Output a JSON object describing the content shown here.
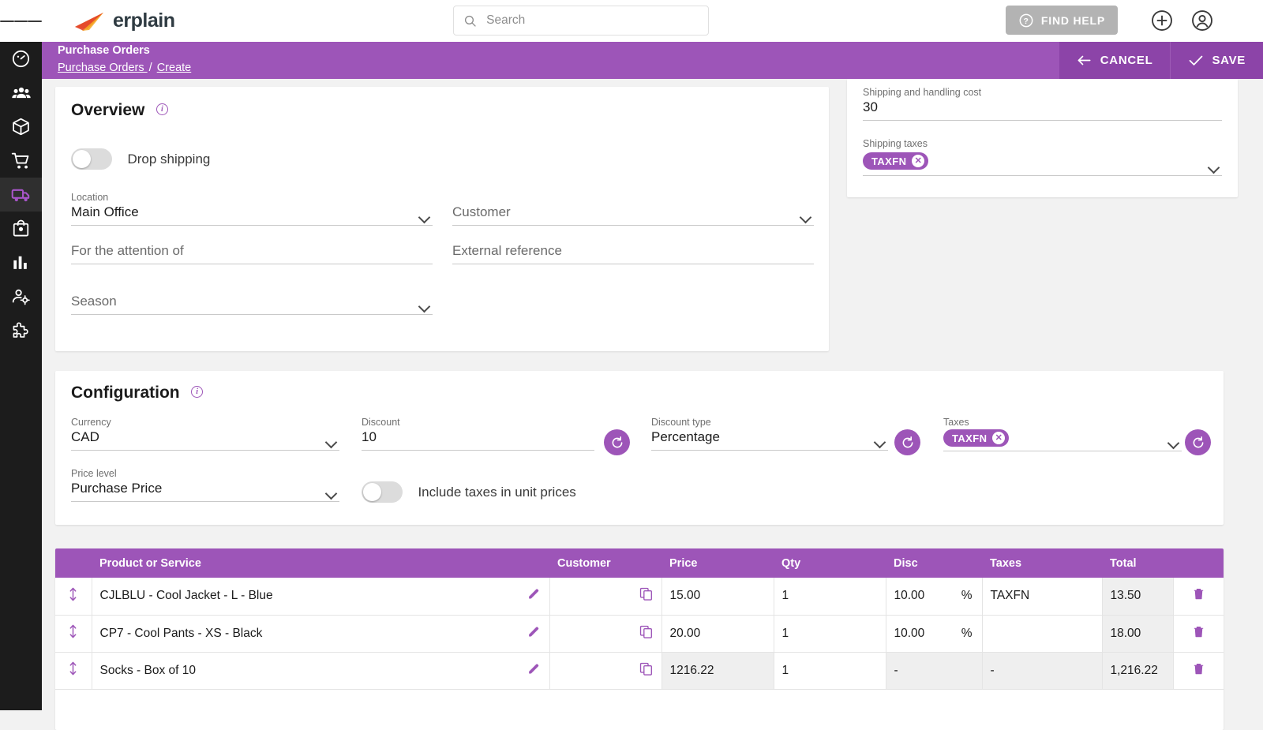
{
  "app": {
    "logo_text": "erplain",
    "accent_purple": "#9d55b8",
    "accent_purple_dark": "#8c44a8",
    "sidebar_bg": "#1c1c1c"
  },
  "topbar": {
    "menu_icon": "hamburger-menu-icon",
    "search": {
      "value": "",
      "placeholder": "Search",
      "icon": "search-icon"
    },
    "find_help_label": "FIND HELP",
    "find_help_icon": "question-circle-icon",
    "add_icon": "plus-circle-icon",
    "account_icon": "user-circle-icon"
  },
  "sidebar": {
    "items": [
      {
        "name": "dashboard",
        "icon": "speedometer-icon",
        "active": false
      },
      {
        "name": "customers",
        "icon": "people-icon",
        "active": false
      },
      {
        "name": "products",
        "icon": "package-box-icon",
        "active": false
      },
      {
        "name": "sales-orders",
        "icon": "shopping-cart-icon",
        "active": false
      },
      {
        "name": "purchase-orders",
        "icon": "truck-icon",
        "active": true
      },
      {
        "name": "inventory",
        "icon": "shopping-bag-icon",
        "active": false
      },
      {
        "name": "reports",
        "icon": "bar-chart-icon",
        "active": false
      },
      {
        "name": "user-settings",
        "icon": "user-gear-icon",
        "active": false
      },
      {
        "name": "integrations",
        "icon": "puzzle-piece-icon",
        "active": false
      }
    ]
  },
  "pageheader": {
    "title": "Purchase Orders",
    "breadcrumb_parent": "Purchase Orders ",
    "breadcrumb_sep": "/",
    "breadcrumb_current": "Create",
    "cancel_label": "CANCEL",
    "cancel_icon": "arrow-left-icon",
    "save_label": "SAVE",
    "save_icon": "check-icon"
  },
  "overview": {
    "title": "Overview",
    "info_icon": "info-icon",
    "drop_shipping": {
      "label": "Drop shipping",
      "enabled": false
    },
    "location": {
      "label": "Location",
      "value": "Main Office",
      "placeholder": ""
    },
    "customer": {
      "label": "",
      "value": "",
      "placeholder": "Customer"
    },
    "attention": {
      "label": "",
      "value": "",
      "placeholder": "For the attention of"
    },
    "external_reference": {
      "label": "",
      "value": "",
      "placeholder": "External reference"
    },
    "season": {
      "label": "",
      "value": "",
      "placeholder": "Season"
    }
  },
  "shipping": {
    "cost": {
      "label": "Shipping and handling cost",
      "value": "30"
    },
    "taxes": {
      "label": "Shipping taxes",
      "chips": [
        "TAXFN"
      ]
    }
  },
  "configuration": {
    "title": "Configuration",
    "info_icon": "info-icon",
    "currency": {
      "label": "Currency",
      "value": "CAD"
    },
    "discount": {
      "label": "Discount",
      "value": "10"
    },
    "discount_type": {
      "label": "Discount type",
      "value": "Percentage"
    },
    "taxes": {
      "label": "Taxes",
      "chips": [
        "TAXFN"
      ]
    },
    "price_level": {
      "label": "Price level",
      "value": "Purchase Price"
    },
    "include_taxes": {
      "label": "Include taxes in unit prices",
      "enabled": false
    },
    "refresh_icon": "refresh-icon"
  },
  "lines_table": {
    "columns": [
      "",
      "Product or Service",
      "Customer",
      "Price",
      "Qty",
      "Disc",
      "Taxes",
      "Total",
      ""
    ],
    "rows": [
      {
        "drag_icon": "drag-updown-icon",
        "product": "CJLBLU - Cool Jacket - L - Blue",
        "edit_icon": "pencil-icon",
        "customer": "",
        "copy_icon": "copy-icon",
        "price": "15.00",
        "qty": "1",
        "disc": "10.00",
        "disc_unit": "%",
        "taxes": "TAXFN",
        "total": "13.50",
        "delete_icon": "trash-icon",
        "disabled": false
      },
      {
        "drag_icon": "drag-updown-icon",
        "product": "CP7 - Cool Pants - XS - Black",
        "edit_icon": "pencil-icon",
        "customer": "",
        "copy_icon": "copy-icon",
        "price": "20.00",
        "qty": "1",
        "disc": "10.00",
        "disc_unit": "%",
        "taxes": "",
        "total": "18.00",
        "delete_icon": "trash-icon",
        "disabled": false
      },
      {
        "drag_icon": "drag-updown-icon",
        "product": "Socks - Box of 10",
        "edit_icon": "pencil-icon",
        "customer": "",
        "copy_icon": "copy-icon",
        "price": "1216.22",
        "qty": "1",
        "disc": "-",
        "disc_unit": "",
        "taxes": "-",
        "total": "1,216.22",
        "delete_icon": "trash-icon",
        "disabled": true
      }
    ]
  }
}
